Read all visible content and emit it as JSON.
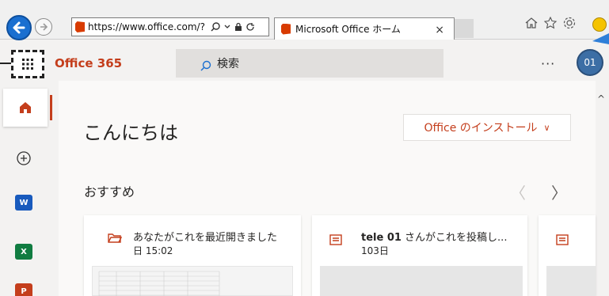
{
  "browser": {
    "url": "https://www.office.com/?",
    "tab_title": "Microsoft Office ホーム",
    "tab_close": "×"
  },
  "header": {
    "brand": "Office 365",
    "search_label": "検索",
    "more_label": "···",
    "avatar_initials": "01"
  },
  "main": {
    "greeting": "こんにちは",
    "install_label": "Office のインストール",
    "install_chevron": "∨",
    "recommended_title": "おすすめ",
    "prev_arrow": "〈",
    "next_arrow": "〉"
  },
  "cards": [
    {
      "line1": "あなたがこれを最近開きました",
      "line2": "日 15:02"
    },
    {
      "line1_bold": "tele 01",
      "line1_rest": " さんがこれを投稿し...",
      "line2": "103日"
    }
  ],
  "rail": {
    "word_letter": "W",
    "excel_letter": "X",
    "ppt_letter": "P"
  },
  "colors": {
    "accent": "#c43e1c",
    "word": "#185abd",
    "excel": "#107c41",
    "powerpoint": "#c43e1c",
    "browser_back": "#1a6fd0"
  }
}
